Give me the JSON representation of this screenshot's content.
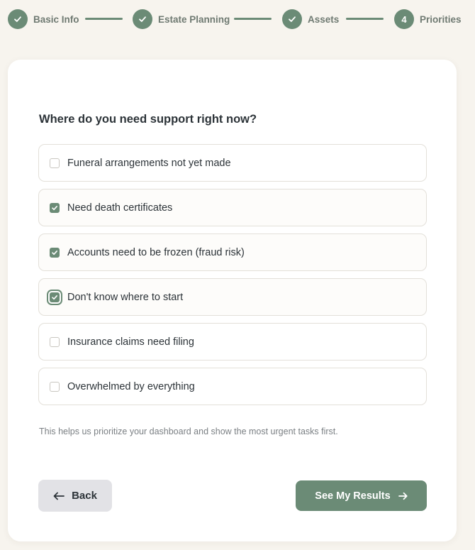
{
  "stepper": {
    "steps": [
      {
        "label": "Basic Info",
        "status": "complete",
        "icon": "check-icon"
      },
      {
        "label": "Estate Planning",
        "status": "complete",
        "icon": "check-icon"
      },
      {
        "label": "Assets",
        "status": "complete",
        "icon": "check-icon"
      },
      {
        "label": "Priorities",
        "status": "current",
        "number": "4"
      }
    ]
  },
  "form": {
    "question": "Where do you need support right now?",
    "options": [
      {
        "label": "Funeral arrangements not yet made",
        "checked": false
      },
      {
        "label": "Need death certificates",
        "checked": true
      },
      {
        "label": "Accounts need to be frozen (fraud risk)",
        "checked": true
      },
      {
        "label": "Don't know where to start",
        "checked": true,
        "focused": true
      },
      {
        "label": "Insurance claims need filing",
        "checked": false
      },
      {
        "label": "Overwhelmed by everything",
        "checked": false
      }
    ],
    "helper_text": "This helps us prioritize your dashboard and show the most urgent tasks first."
  },
  "actions": {
    "back_label": "Back",
    "back_icon": "arrow-left-icon",
    "submit_label": "See My Results",
    "submit_icon": "arrow-right-icon"
  },
  "colors": {
    "accent": "#6b8b76",
    "background": "#f7f4ee",
    "card": "#ffffff",
    "back_button": "#e2e2e6"
  }
}
